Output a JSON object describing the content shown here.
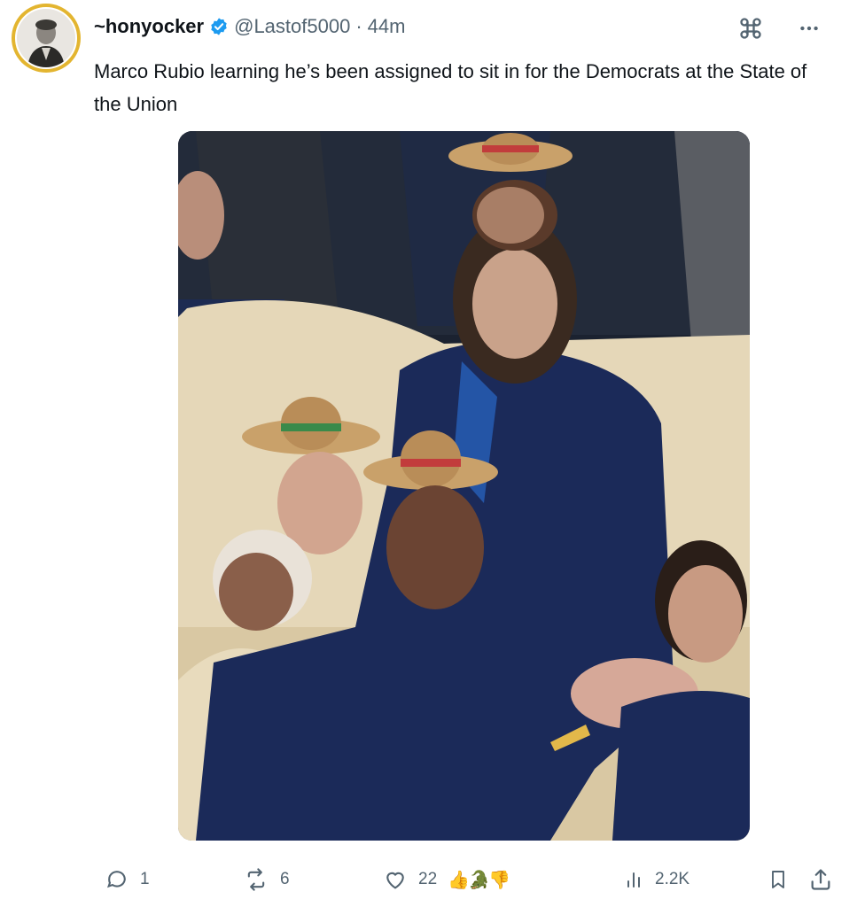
{
  "author": {
    "display_name": "~honyocker",
    "handle": "@Lastof5000",
    "separator": "·",
    "time": "44m",
    "verified": true
  },
  "post": {
    "text": "Marco Rubio learning he’s been assigned to sit in for the Democrats at the State of the Union"
  },
  "media": {
    "alt": "Meme photo: man in navy suit seated on cream sofa wearing a long-haired wig, surrounded by cut-out face masks wearing sombreros"
  },
  "top_icons": [
    "command-icon",
    "more-icon"
  ],
  "actions": {
    "replies": "1",
    "reposts": "6",
    "likes": "22",
    "reactions": "👍🐊👎",
    "views": "2.2K"
  },
  "colors": {
    "text": "#0f1419",
    "muted": "#536471",
    "verified_blue": "#1d9bf0",
    "avatar_ring": "#e3b530"
  }
}
